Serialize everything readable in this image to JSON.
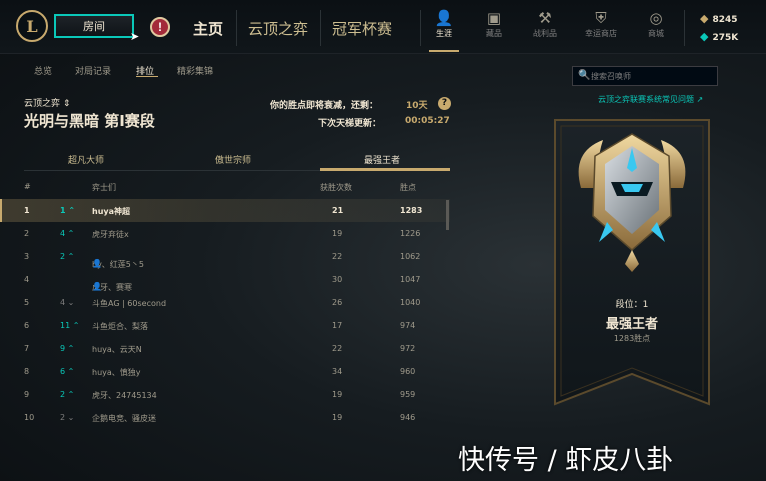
{
  "topbar": {
    "logo": "L",
    "room_label": "房间",
    "alert_label": "!",
    "nav": [
      "主页",
      "云顶之弈",
      "冠军杯赛"
    ],
    "icons": [
      {
        "label": "生涯",
        "glyph": "person-icon"
      },
      {
        "label": "藏品",
        "glyph": "chest-icon"
      },
      {
        "label": "战利品",
        "glyph": "hammer-icon"
      },
      {
        "label": "幸运商店",
        "glyph": "shield-icon"
      },
      {
        "label": "商城",
        "glyph": "coins-icon"
      }
    ],
    "currency": {
      "rp": "8245",
      "be": "275K"
    }
  },
  "subnav": {
    "tabs": [
      "总览",
      "对局记录",
      "排位",
      "精彩集锦"
    ],
    "active": "排位"
  },
  "header": {
    "mode": "云顶之弈",
    "season": "光明与黑暗 第Ⅰ赛段",
    "decay_label": "你的胜点即将衰减，还剩：",
    "decay_value": "10天",
    "update_label": "下次天梯更新：",
    "update_value": "00:05:27"
  },
  "tier_tabs": [
    "超凡大师",
    "傲世宗师",
    "最强王者"
  ],
  "columns": {
    "rank": "#",
    "name": "弈士们",
    "wins": "获胜次数",
    "lp": "胜点"
  },
  "rows": [
    {
      "rank": "1",
      "trend": "1 ⌃",
      "name": "huya神超",
      "wins": "21",
      "lp": "1283"
    },
    {
      "rank": "2",
      "trend": "4 ⌃",
      "name": "虎牙弃徒x",
      "wins": "19",
      "lp": "1226"
    },
    {
      "rank": "3",
      "trend": "2 ⌃",
      "name": "hy、红莲5丶5",
      "wins": "22",
      "lp": "1062"
    },
    {
      "rank": "4",
      "trend": "",
      "name": "虎牙、赛寒",
      "wins": "30",
      "lp": "1047"
    },
    {
      "rank": "5",
      "trend": "4 ⌄",
      "name": "斗鱼AG | 60second",
      "wins": "26",
      "lp": "1040"
    },
    {
      "rank": "6",
      "trend": "11 ⌃",
      "name": "斗鱼炬合、梨落",
      "wins": "17",
      "lp": "974"
    },
    {
      "rank": "7",
      "trend": "9 ⌃",
      "name": "huya、云天N",
      "wins": "22",
      "lp": "972"
    },
    {
      "rank": "8",
      "trend": "6 ⌃",
      "name": "huya、慎独y",
      "wins": "34",
      "lp": "960"
    },
    {
      "rank": "9",
      "trend": "2 ⌃",
      "name": "虎牙、24745134",
      "wins": "19",
      "lp": "959"
    },
    {
      "rank": "10",
      "trend": "2 ⌄",
      "name": "企鹅电竞、骚皮迷",
      "wins": "19",
      "lp": "946"
    }
  ],
  "sidebar": {
    "search_placeholder": "搜索召唤师",
    "faq_link": "云顶之弈联赛系统常见问题 ↗",
    "rank_label": "段位：1",
    "rank_name": "最强王者",
    "rank_lp": "1283胜点"
  },
  "watermark": "快传号 / 虾皮八卦"
}
